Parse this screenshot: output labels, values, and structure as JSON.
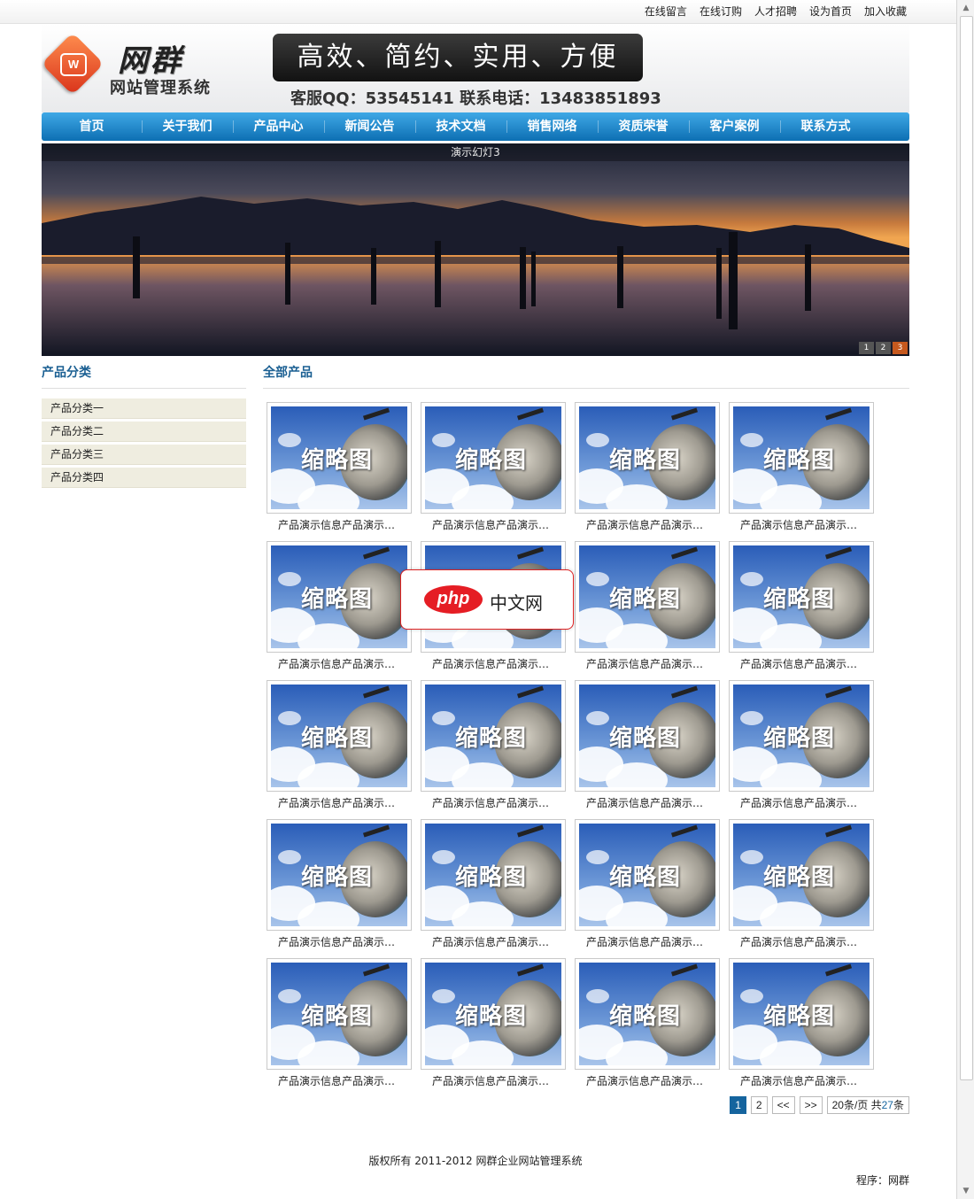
{
  "topbar": {
    "links": [
      "在线留言",
      "在线订购",
      "人才招聘",
      "设为首页",
      "加入收藏"
    ]
  },
  "header": {
    "logo_title": "网群",
    "logo_subtitle": "网站管理系统",
    "logo_mark": "W",
    "slogan": "高效、简约、实用、方便",
    "contact": "客服QQ：53545141 联系电话：13483851893"
  },
  "nav": {
    "items": [
      "首页",
      "关于我们",
      "产品中心",
      "新闻公告",
      "技术文档",
      "销售网络",
      "资质荣誉",
      "客户案例",
      "联系方式"
    ]
  },
  "banner": {
    "caption": "演示幻灯3",
    "dots": [
      "1",
      "2",
      "3"
    ],
    "active_dot": 3
  },
  "sidebar": {
    "title": "产品分类",
    "categories": [
      "产品分类一",
      "产品分类二",
      "产品分类三",
      "产品分类四"
    ]
  },
  "main": {
    "title": "全部产品",
    "thumb_text": "缩略图",
    "product_title": "产品演示信息产品演示信息",
    "product_count": 20
  },
  "pager": {
    "pages": [
      "1",
      "2"
    ],
    "current": "1",
    "prev": "<<",
    "next": ">>",
    "per_page_text": "20条/页 共",
    "total": "27",
    "total_suffix": "条"
  },
  "footer": {
    "copyright": "版权所有 2011-2012 网群企业网站管理系统",
    "program": "程序：网群"
  },
  "watermark": {
    "brand": "php",
    "text": "中文网"
  }
}
